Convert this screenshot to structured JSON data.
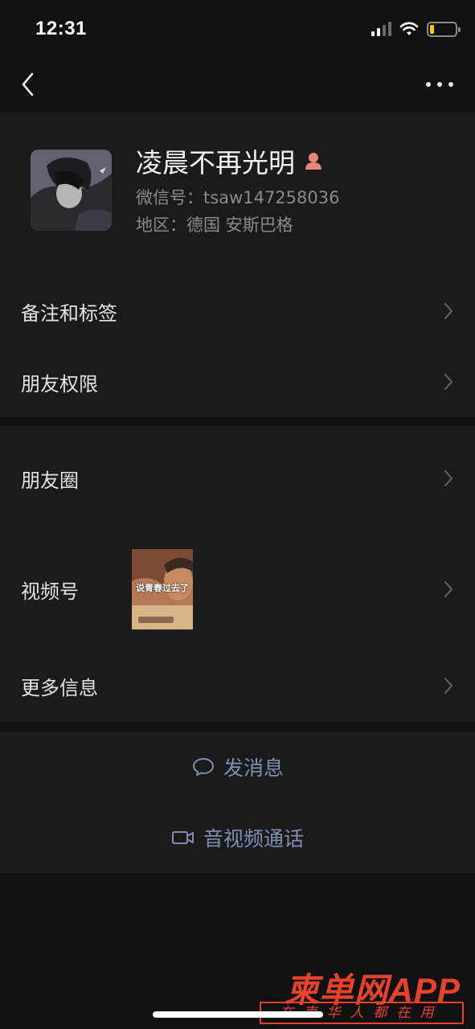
{
  "status_bar": {
    "time": "12:31",
    "signal_bars": 4,
    "signal_active": 2,
    "battery_level": 0.15,
    "battery_color": "#f5d000"
  },
  "nav": {
    "back_icon": "chevron-left-icon",
    "more_icon": "more-dots-icon"
  },
  "profile": {
    "name": "凌晨不再光明",
    "gender_icon": "female-icon",
    "wechat_id": "微信号：tsaw147258036",
    "region": "地区：德国 安斯巴格"
  },
  "rows": {
    "remark_tags": "备注和标签",
    "friend_permissions": "朋友权限",
    "moments": "朋友圈",
    "channels": "视频号",
    "channels_thumb_text": "说青春过去了",
    "more_info": "更多信息"
  },
  "actions": {
    "send_message": "发消息",
    "send_message_icon": "chat-bubble-icon",
    "video_call": "音视频通话",
    "video_call_icon": "video-camera-icon",
    "accent_color": "#7d90b4"
  },
  "watermark": {
    "logo": "柬单网APP",
    "tagline": "在柬华人都在用",
    "color": "#e8422b"
  }
}
